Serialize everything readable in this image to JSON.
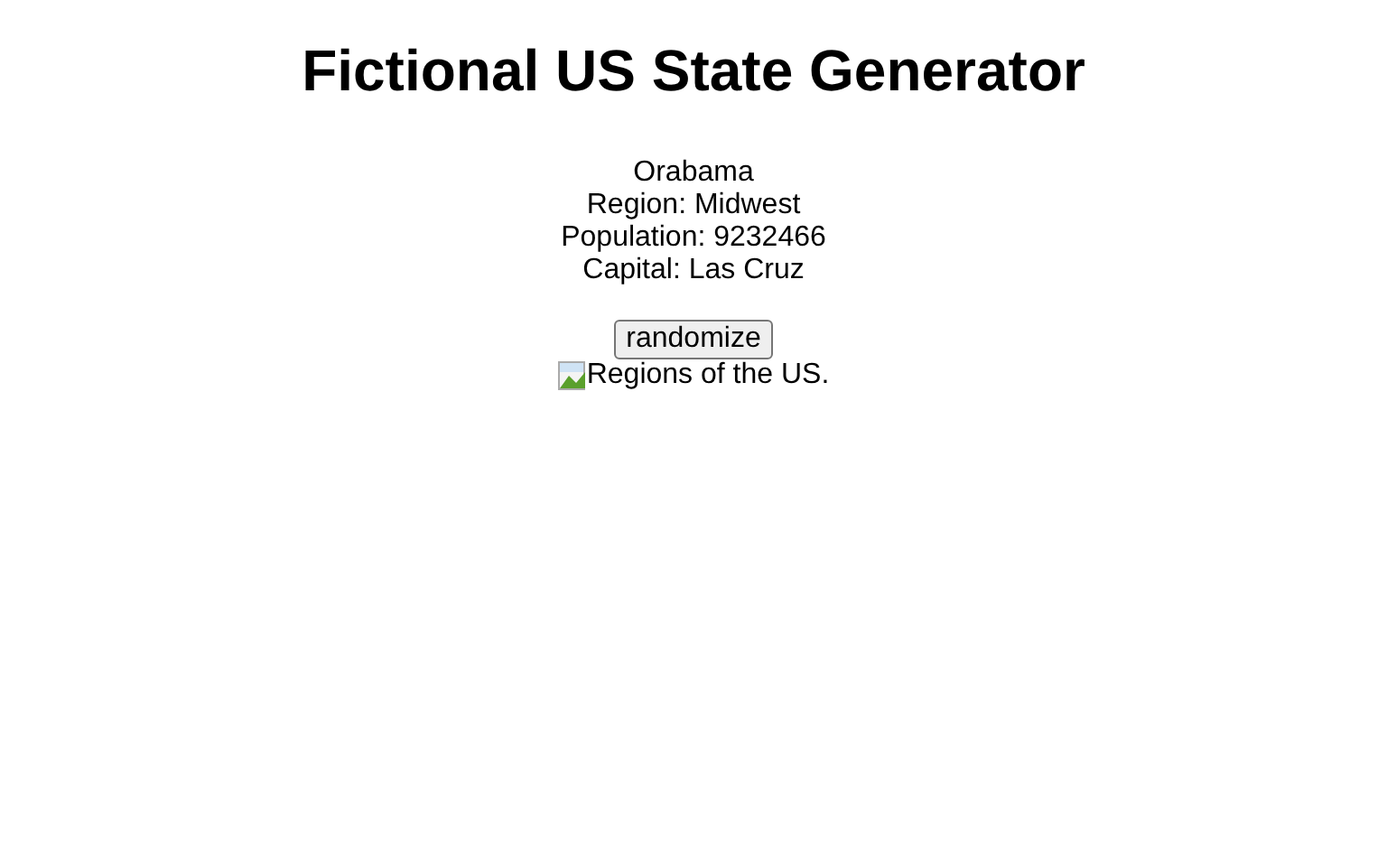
{
  "title": "Fictional US State Generator",
  "state": {
    "name": "Orabama",
    "region": "Region: Midwest",
    "population": "Population: 9232466",
    "capital": "Capital: Las Cruz"
  },
  "button": "randomize",
  "image": {
    "alt": "Regions of the US."
  }
}
